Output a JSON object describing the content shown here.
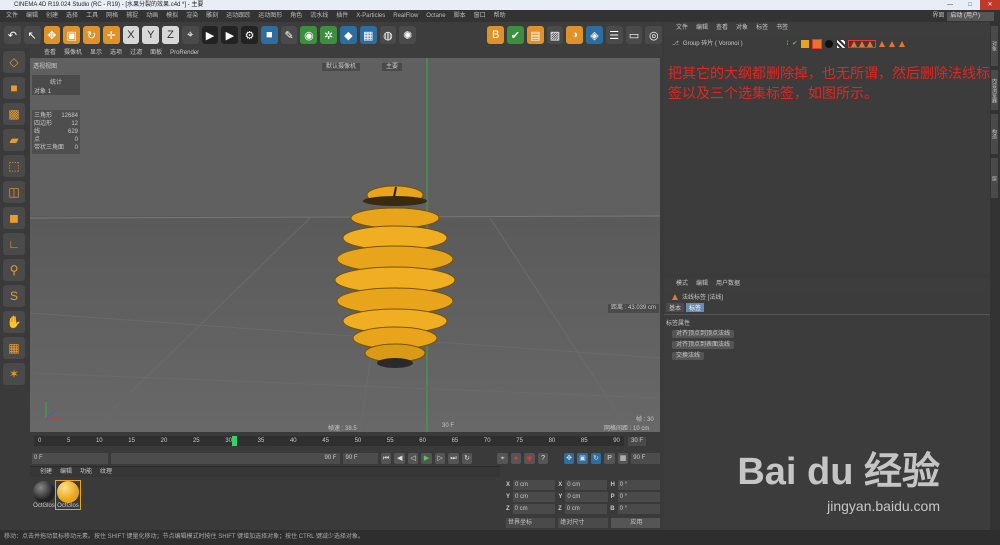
{
  "window": {
    "title": "CINEMA 4D R19.024 Studio (RC - R19) - [水果分裂的效果.c4d *] - 主要",
    "buttons": [
      "—",
      "□",
      "✕"
    ]
  },
  "menu": [
    "文件",
    "编辑",
    "创建",
    "选择",
    "工具",
    "网格",
    "捕捉",
    "动画",
    "模拟",
    "渲染",
    "雕刻",
    "运动跟踪",
    "运动图形",
    "角色",
    "流水线",
    "插件",
    "X-Particles",
    "RealFlow",
    "Octane",
    "脚本",
    "窗口",
    "帮助"
  ],
  "layout": {
    "label": "界面",
    "value": "启动 (用户)"
  },
  "viewport": {
    "menu": [
      "查看",
      "摄像机",
      "显示",
      "选项",
      "过滤",
      "面板",
      "ProRender"
    ],
    "name": "透视视图",
    "camera": "默认摄像机",
    "camera_extra": "主要",
    "statbox": {
      "title": "统计",
      "objects_label": "对象",
      "objects_value": "1"
    },
    "stats": [
      {
        "k": "三角形",
        "v": "12684"
      },
      {
        "k": "四边形",
        "v": "12"
      },
      {
        "k": "线",
        "v": "629"
      },
      {
        "k": "点",
        "v": "0"
      },
      {
        "k": "带状三角面",
        "v": "0"
      }
    ],
    "distance": "距离 : 43.039 cm",
    "speed": "帧速 : 38.5",
    "frame_center": "30 F",
    "frame_right": "帧 : 30",
    "grid": "网格间距 : 10 cm"
  },
  "timeline": {
    "ticks": [
      "0",
      "5",
      "10",
      "15",
      "20",
      "25",
      "30",
      "35",
      "40",
      "45",
      "50",
      "55",
      "60",
      "65",
      "70",
      "75",
      "80",
      "85",
      "90"
    ],
    "current": "30 F",
    "current_fraction": 0.333
  },
  "playbar": {
    "start": "0 F",
    "min": "90 F",
    "max": "90 F",
    "end": "90 F"
  },
  "materials": {
    "menu": [
      "创建",
      "编辑",
      "功能",
      "纹理"
    ],
    "items": [
      {
        "name": "OctGlos",
        "color": "#222222"
      },
      {
        "name": "OctGlos",
        "color": "#e8a51c"
      }
    ]
  },
  "coords": {
    "rows": [
      [
        "X",
        "0 cm",
        "X",
        "0 cm",
        "H",
        "0 °"
      ],
      [
        "Y",
        "0 cm",
        "Y",
        "0 cm",
        "P",
        "0 °"
      ],
      [
        "Z",
        "0 cm",
        "Z",
        "0 cm",
        "B",
        "0 °"
      ]
    ],
    "mode": "世界坐标",
    "scale": "绝对尺寸",
    "apply": "应用"
  },
  "object_manager": {
    "menu": [
      "文件",
      "编辑",
      "查看",
      "对象",
      "标签",
      "书签"
    ],
    "object": "Group 碎片 ( Voronoi )"
  },
  "note": "把其它的大纲都删除掉，也无所谓，然后删除法线标签以及三个选集标签，如图所示。",
  "attributes": {
    "menu": [
      "模式",
      "编辑",
      "用户数据"
    ],
    "tag_title": "法线标签 [法线]",
    "tabs": [
      "基本",
      "标签"
    ],
    "section": "标签属性",
    "buttons": [
      "对齐顶点到顶点法线",
      "对齐顶点到表面法线",
      "交换法线"
    ]
  },
  "right_tabs": [
    "对象",
    "内容浏览器",
    "构造",
    "层"
  ],
  "status": "移动：点击并拖动鼠标移动元素。按住 SHIFT 键量化移动；节点编辑模式时按住 SHIFT 键增加选择对象；按住 CTRL 键减少选择对象。",
  "watermark": {
    "brand": "Bai du 经验",
    "url": "jingyan.baidu.com"
  },
  "colors": {
    "accent": "#e8a51c",
    "note": "#e5251f"
  }
}
